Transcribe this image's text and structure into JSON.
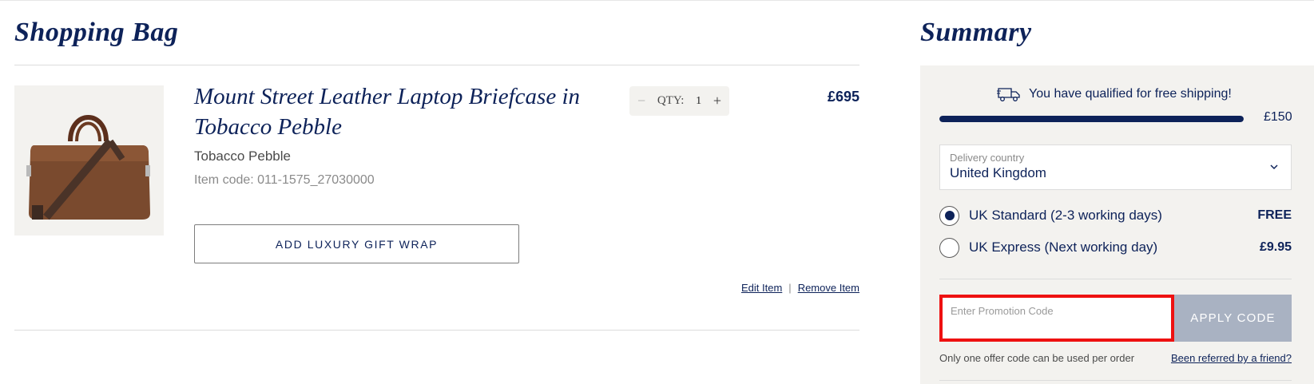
{
  "bag": {
    "title": "Shopping Bag",
    "item": {
      "name": "Mount Street Leather Laptop Briefcase in Tobacco Pebble",
      "variant": "Tobacco Pebble",
      "code": "Item code: 011-1575_27030000",
      "qty_label": "QTY:",
      "qty_value": "1",
      "qty_minus": "−",
      "qty_plus": "+",
      "price": "£695",
      "gift_wrap_label": "ADD LUXURY GIFT WRAP",
      "edit_label": "Edit Item",
      "separator": "|",
      "remove_label": "Remove Item"
    }
  },
  "summary": {
    "title": "Summary",
    "free_shipping_message": "You have qualified for free shipping!",
    "progress_label": "£150",
    "progress_fraction": 1.0,
    "delivery_country_label": "Delivery country",
    "delivery_country_value": "United Kingdom",
    "shipping_options": [
      {
        "label": "UK Standard (2-3 working days)",
        "price": "FREE",
        "selected": true
      },
      {
        "label": "UK Express (Next working day)",
        "price": "£9.95",
        "selected": false
      }
    ],
    "promo_placeholder": "Enter Promotion Code",
    "promo_value": "",
    "apply_label": "APPLY CODE",
    "promo_note": "Only one offer code can be used per order",
    "referral_link": "Been referred by a friend?"
  },
  "colors": {
    "navy": "#0d2259",
    "panel": "#f3f2ef",
    "apply_disabled": "#a9b2c2",
    "highlight": "#ee1111"
  },
  "icons": {
    "truck": "truck-icon",
    "chevron": "chevron-down-icon"
  }
}
